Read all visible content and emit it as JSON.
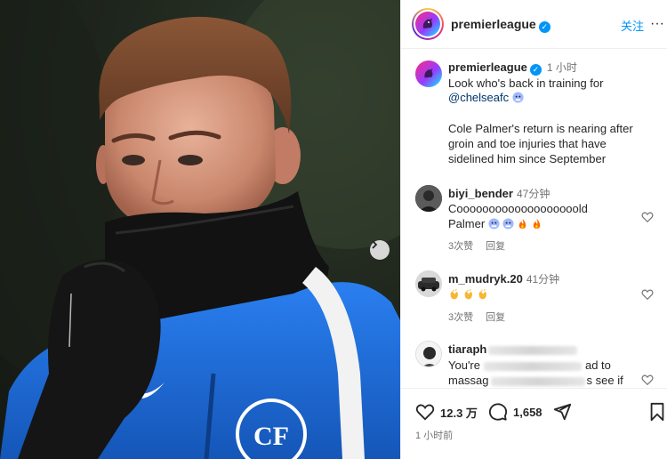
{
  "post": {
    "account": "premierleague",
    "follow_label": "关注",
    "more_label": "···",
    "caption": {
      "username": "premierleague",
      "time": "1 小时",
      "line1": "Look who's back in training for",
      "mention": "@chelseafc",
      "line2": "Cole Palmer's return is nearing after",
      "line3": "groin and toe injuries that have",
      "line4": "sidelined him since September"
    }
  },
  "comments": [
    {
      "username": "biyi_bender",
      "time": "47分钟",
      "text_line1": "Cooooooooooooooooooold",
      "text_line2": "Palmer",
      "emojis": [
        "cold-face",
        "cold-face",
        "fire",
        "fire"
      ],
      "likes": "3次赞",
      "reply": "回复"
    },
    {
      "username": "m_mudryk.20",
      "time": "41分钟",
      "emojis": [
        "clapping-hands",
        "clapping-hands",
        "clapping-hands"
      ],
      "likes": "3次赞",
      "reply": "回复"
    },
    {
      "username_visible": "tiaraph",
      "text_start": "You're",
      "text_end": "ad to",
      "text2_start": "massag",
      "text2_end": "s see if"
    }
  ],
  "stats": {
    "likes": "12.3 万",
    "comments": "1,658",
    "posted": "1 小时前"
  },
  "icons": {
    "like": "heart-outline-icon",
    "comment": "comment-bubble-icon",
    "share": "paper-plane-icon",
    "save": "bookmark-icon",
    "next": "chevron-right-icon",
    "verified": "verified-badge-icon"
  },
  "colors": {
    "link": "#0095f6",
    "mention": "#00376b",
    "muted": "#737373",
    "kit_blue": "#1f6fd6"
  }
}
